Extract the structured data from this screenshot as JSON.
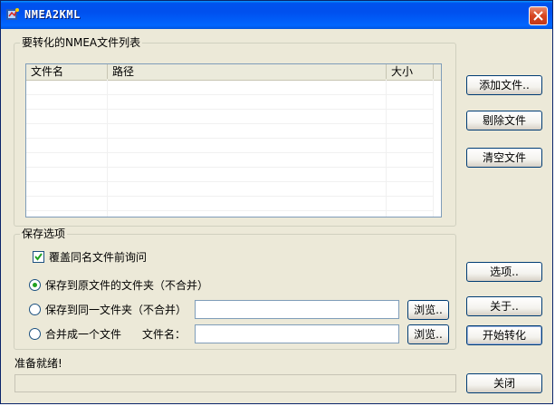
{
  "window": {
    "title": "NMEA2KML"
  },
  "file_list": {
    "group_title": "要转化的NMEA文件列表",
    "columns": [
      "文件名",
      "路径",
      "大小"
    ],
    "rows": []
  },
  "buttons": {
    "add_file": "添加文件..",
    "remove_file": "剔除文件",
    "clear_files": "清空文件",
    "options": "选项..",
    "about": "关于..",
    "start_convert": "开始转化",
    "close": "关闭"
  },
  "save_options": {
    "group_title": "保存选项",
    "overwrite_prompt": {
      "label": "覆盖同名文件前询问",
      "checked": true
    },
    "radio_original": {
      "label": "保存到原文件的文件夹（不合并）",
      "checked": true
    },
    "radio_same_folder": {
      "label": "保存到同一文件夹（不合并）",
      "checked": false,
      "path_value": "",
      "browse_label": "浏览.."
    },
    "radio_merge": {
      "label": "合并成一个文件",
      "checked": false,
      "filename_label": "文件名：",
      "filename_value": "",
      "browse_label": "浏览.."
    }
  },
  "status": {
    "text": "准备就绪!",
    "progress": 0
  }
}
